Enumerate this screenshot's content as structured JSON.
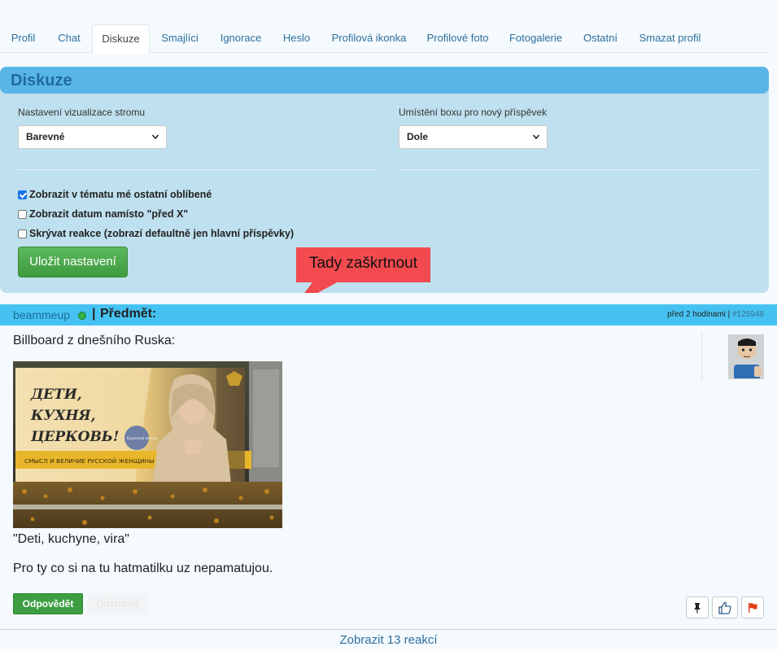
{
  "tabs": [
    {
      "label": "Profil",
      "active": false
    },
    {
      "label": "Chat",
      "active": false
    },
    {
      "label": "Diskuze",
      "active": true
    },
    {
      "label": "Smajlíci",
      "active": false
    },
    {
      "label": "Ignorace",
      "active": false
    },
    {
      "label": "Heslo",
      "active": false
    },
    {
      "label": "Profilová ikonka",
      "active": false
    },
    {
      "label": "Profilové foto",
      "active": false
    },
    {
      "label": "Fotogalerie",
      "active": false
    },
    {
      "label": "Ostatní",
      "active": false
    },
    {
      "label": "Smazat profil",
      "active": false
    }
  ],
  "settings": {
    "title": "Diskuze",
    "tree_label": "Nastavení vizualizace stromu",
    "tree_value": "Barevné",
    "box_label": "Umístění boxu pro nový příspěvek",
    "box_value": "Dole",
    "checkboxes": [
      {
        "label": "Zobrazit v tématu mé ostatní oblíbené",
        "checked": true
      },
      {
        "label": "Zobrazit datum namísto \"před X\"",
        "checked": false
      },
      {
        "label": "Skrývat reakce (zobrazí defaultně jen hlavní příspěvky)",
        "checked": false
      }
    ],
    "save_label": "Uložit nastavení",
    "callout_text": "Tady zaškrtnout",
    "callout_color": "#f24a4e"
  },
  "post": {
    "author": "beammeup",
    "online": true,
    "separator": "|",
    "subject_label": "Předmět:",
    "time": "před 2 hodinami",
    "meta_sep": "|",
    "post_id": "#125948",
    "text_1": "Billboard z dnešního Ruska:",
    "billboard_lines": [
      "ДЕТИ,",
      "КУХНЯ,",
      "ЦЕРКОВЬ!"
    ],
    "billboard_banner": "СМЫСЛ И ВЕЛИЧИЕ РУССКОЙ ЖЕНЩИНЫ",
    "billboard_badge": "Крымский вектор",
    "text_2": "\"Deti, kuchyne, vira\"",
    "text_3": "Pro ty co si na tu hatmatilku uz nepamatujou.",
    "reply_label": "Odpovědět",
    "remove_label": "Odstranit",
    "icons": [
      "pin-icon",
      "thumbs-up-icon",
      "flag-icon"
    ]
  },
  "footer": {
    "show_reactions": "Zobrazit 13 reakcí"
  },
  "colors": {
    "accent": "#58b6e6",
    "panel_bg": "#bfe0ee",
    "post_header": "#46c2f2",
    "primary_button": "#3d9e41",
    "link": "#2f6f9f"
  }
}
